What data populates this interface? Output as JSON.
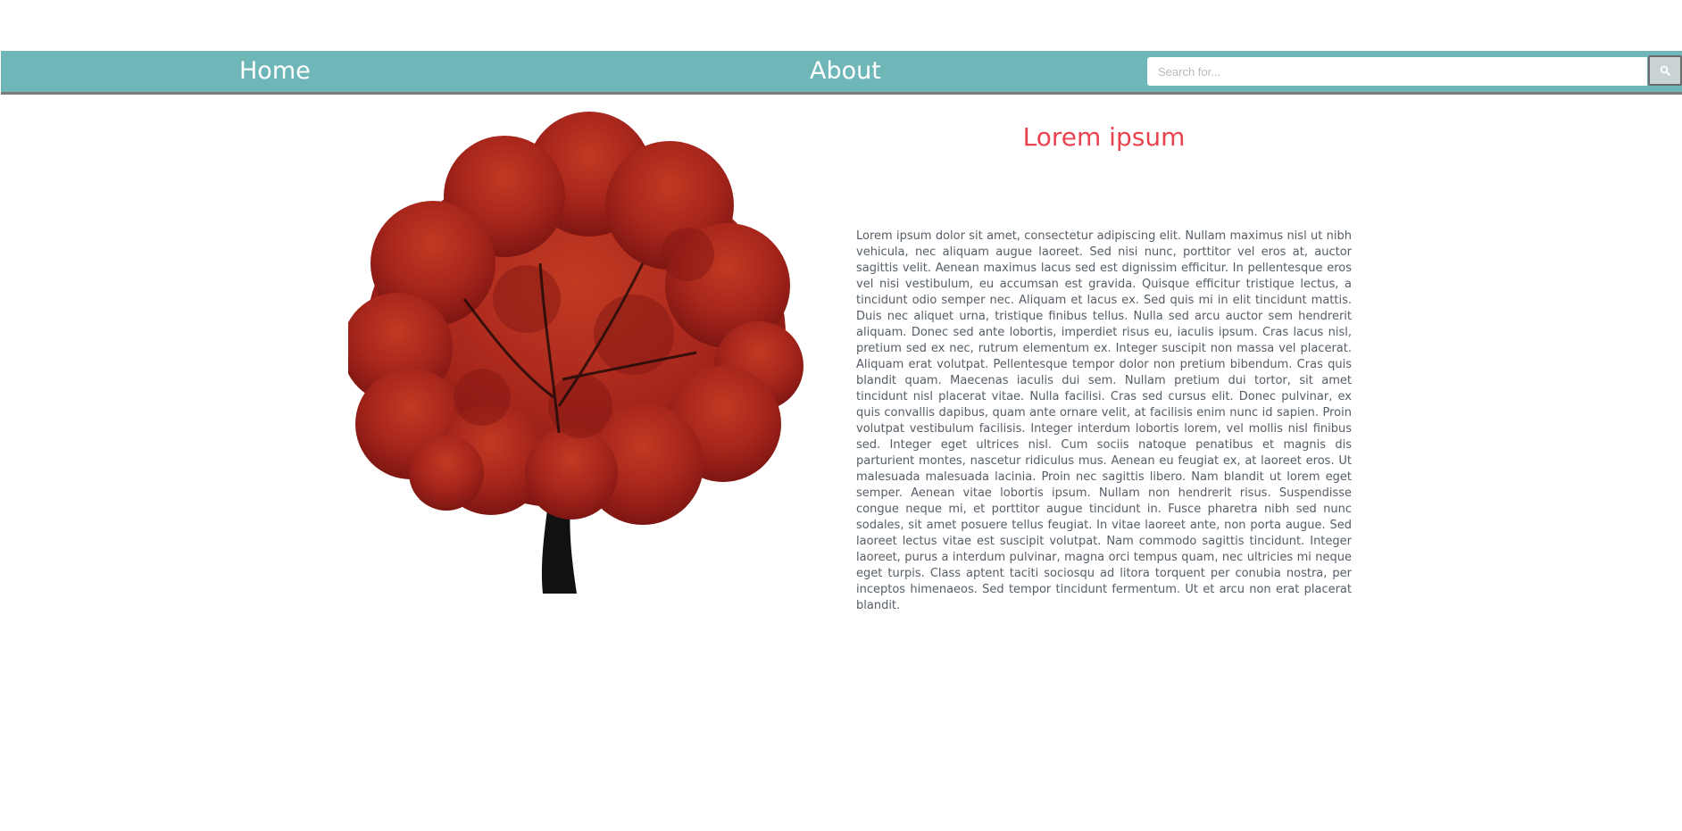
{
  "nav": {
    "items": [
      {
        "label": "Home"
      },
      {
        "label": "About"
      }
    ],
    "search": {
      "placeholder": "Search for...",
      "value": "",
      "button_icon": "search-icon"
    }
  },
  "hero": {
    "image": "red-maple-tree"
  },
  "article": {
    "title": "Lorem ipsum",
    "body": "Lorem ipsum dolor sit amet, consectetur adipiscing elit. Nullam maximus nisl ut nibh vehicula, nec aliquam augue laoreet. Sed nisi nunc, porttitor vel eros at, auctor sagittis velit. Aenean maximus lacus sed est dignissim efficitur. In pellentesque eros vel nisi vestibulum, eu accumsan est gravida. Quisque efficitur tristique lectus, a tincidunt odio semper nec. Aliquam et lacus ex. Sed quis mi in elit tincidunt mattis. Duis nec aliquet urna, tristique finibus tellus. Nulla sed arcu auctor sem hendrerit aliquam. Donec sed ante lobortis, imperdiet risus eu, iaculis ipsum. Cras lacus nisl, pretium sed ex nec, rutrum elementum ex. Integer suscipit non massa vel placerat. Aliquam erat volutpat. Pellentesque tempor dolor non pretium bibendum. Cras quis blandit quam. Maecenas iaculis dui sem. Nullam pretium dui tortor, sit amet tincidunt nisl placerat vitae. Nulla facilisi. Cras sed cursus elit. Donec pulvinar, ex quis convallis dapibus, quam ante ornare velit, at facilisis enim nunc id sapien. Proin volutpat vestibulum facilisis. Integer interdum lobortis lorem, vel mollis nisl finibus sed. Integer eget ultrices nisl. Cum sociis natoque penatibus et magnis dis parturient montes, nascetur ridiculus mus. Aenean eu feugiat ex, at laoreet eros. Ut malesuada malesuada lacinia. Proin nec sagittis libero. Nam blandit ut lorem eget semper. Aenean vitae lobortis ipsum. Nullam non hendrerit risus. Suspendisse congue neque mi, et porttitor augue tincidunt in. Fusce pharetra nibh sed nunc sodales, sit amet posuere tellus feugiat. In vitae laoreet ante, non porta augue. Sed laoreet lectus vitae est suscipit volutpat. Nam commodo sagittis tincidunt. Integer laoreet, purus a interdum pulvinar, magna orci tempus quam, nec ultricies mi neque eget turpis. Class aptent taciti sociosqu ad litora torquent per conubia nostra, per inceptos himenaeos. Sed tempor tincidunt fermentum. Ut et arcu non erat placerat blandit."
  },
  "colors": {
    "navbar": "#6fb6b9",
    "navbar_border": "#7c7c7c",
    "title": "#e8434f",
    "body_text": "#555d66",
    "foliage": "#a8261c",
    "trunk": "#111111"
  }
}
